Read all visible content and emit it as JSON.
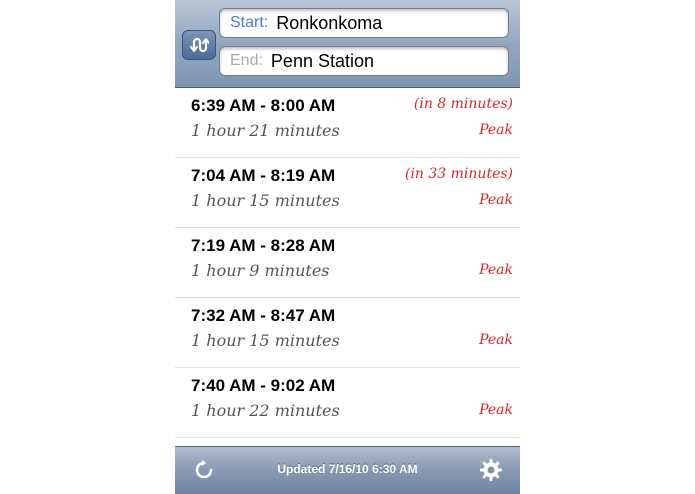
{
  "header": {
    "start_label": "Start:",
    "start_value": "Ronkonkoma",
    "end_label": "End:",
    "end_value": "Penn Station"
  },
  "trains": [
    {
      "times": "6:39 AM - 8:00 AM",
      "duration": "1 hour 21 minutes",
      "eta": "(in 8 minutes)",
      "status": "Peak"
    },
    {
      "times": "7:04 AM - 8:19 AM",
      "duration": "1 hour 15 minutes",
      "eta": "(in 33 minutes)",
      "status": "Peak"
    },
    {
      "times": "7:19 AM - 8:28 AM",
      "duration": "1 hour 9 minutes",
      "eta": "",
      "status": "Peak"
    },
    {
      "times": "7:32 AM - 8:47 AM",
      "duration": "1 hour 15 minutes",
      "eta": "",
      "status": "Peak"
    },
    {
      "times": "7:40 AM - 9:02 AM",
      "duration": "1 hour 22 minutes",
      "eta": "",
      "status": "Peak"
    }
  ],
  "toolbar": {
    "updated_text": "Updated 7/16/10 6:30 AM",
    "refresh_icon": "refresh-icon",
    "settings_icon": "gear-icon"
  },
  "colors": {
    "accent_red": "#d42a2a",
    "start_label_blue": "#4a7bd6",
    "header_blue": "#93a7bf"
  }
}
